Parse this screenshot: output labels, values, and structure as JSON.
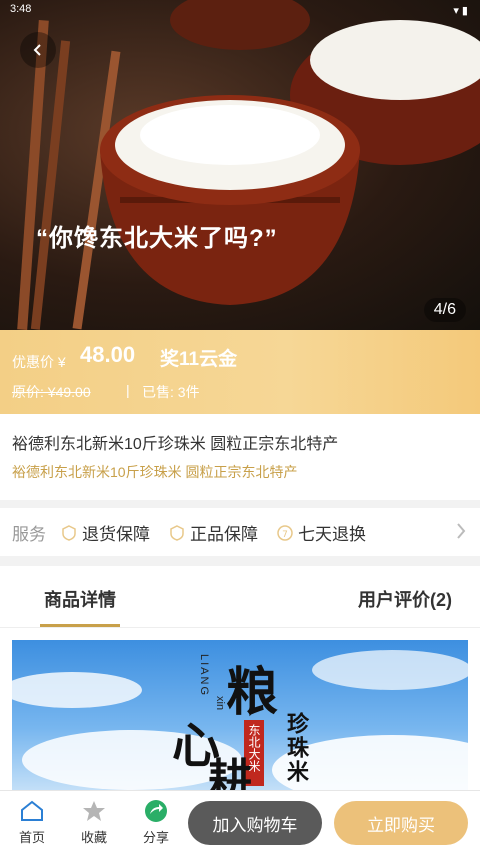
{
  "status": {
    "time": "3:48"
  },
  "hero": {
    "slogan": "“你馋东北大米了吗?”",
    "counter": "4/6"
  },
  "price": {
    "label": "优惠价 ¥",
    "current": "48.00",
    "reward": "奖11云金",
    "original": "原价: ¥49.00",
    "separator": "|",
    "sold": "已售: 3件"
  },
  "product": {
    "title": "裕德利东北新米10斤珍珠米 圆粒正宗东北特产",
    "subtitle": "裕德利东北新米10斤珍珠米 圆粒正宗东北特产"
  },
  "service": {
    "label": "服务",
    "items": [
      "退货保障",
      "正品保障",
      "七天退换"
    ]
  },
  "tabs": {
    "details": "商品详情",
    "reviews": "用户评价(2)"
  },
  "detail_image": {
    "pinyin_top": "LIANG",
    "pinyin_side": "xin",
    "brand_chars": [
      "粮",
      "心",
      "耕"
    ],
    "right_text": "珍珠米",
    "seal_text": "东北大米"
  },
  "bottom_nav": {
    "home": "首页",
    "favorite": "收藏",
    "share": "分享",
    "add_cart": "加入购物车",
    "buy_now": "立即购买"
  },
  "colors": {
    "gold": "#c8a04a",
    "price_bar": "#f3cf86",
    "buy_button": "#ecc17a",
    "cart_button": "#5a5a5a",
    "share_green": "#2aae67",
    "home_blue": "#2b7fd4"
  }
}
